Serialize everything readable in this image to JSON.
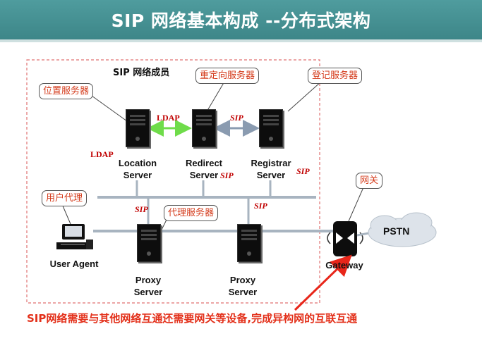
{
  "banner": {
    "title": "SIP 网络基本构成  --分布式架构"
  },
  "members_title": "SIP 网络成员",
  "callouts": {
    "location": "位置服务器",
    "redirect": "重定向服务器",
    "registrar": "登记服务器",
    "user_agent": "用户代理",
    "proxy": "代理服务器",
    "gateway": "网关"
  },
  "nodes": {
    "location": "Location\nServer",
    "redirect": "Redirect\nServer",
    "registrar": "Registrar\nServer",
    "user_agent": "User Agent",
    "proxy1": "Proxy\nServer",
    "proxy2": "Proxy\nServer",
    "gateway": "Gateway",
    "pstn": "PSTN"
  },
  "protocols": {
    "ldap_top": "LDAP",
    "ldap_side": "LDAP",
    "sip_top": "SIP",
    "sip_redirect": "SIP",
    "sip_registrar": "SIP",
    "sip_proxy1": "SIP",
    "sip_proxy2": "SIP"
  },
  "footer": "SIP网络需要与其他网络互通还需要网关等设备,完成异构网的互联互通",
  "colors": {
    "banner": "#4a9799",
    "callout_text": "#d43a1a",
    "protocol_text": "#c00000",
    "ldap_link": "#6fdc4a",
    "footer_text": "#e3301a",
    "arrow": "#e8261a"
  }
}
